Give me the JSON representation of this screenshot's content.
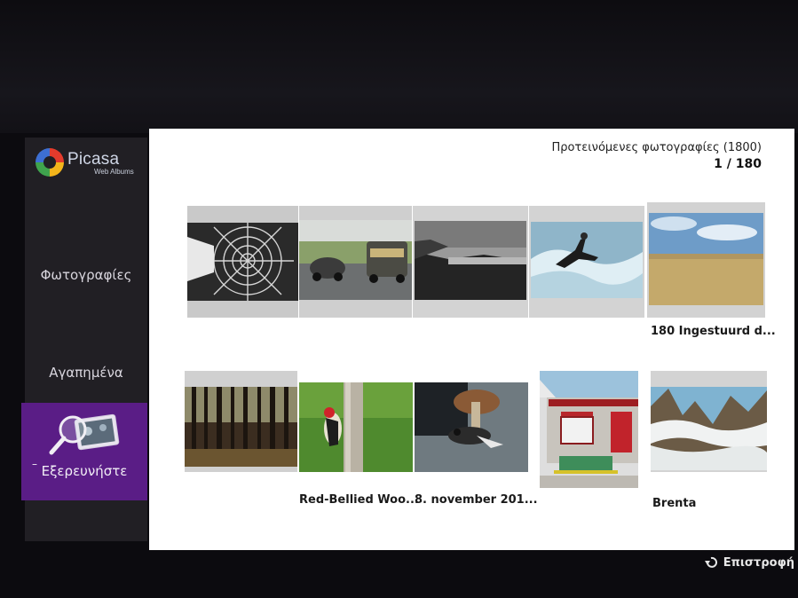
{
  "app": {
    "logo_name": "Picasa",
    "logo_sub": "Web Albums"
  },
  "sidebar": {
    "items": [
      {
        "label": "Φωτογραφίες",
        "icon": "photos"
      },
      {
        "label": "Αγαπημένα",
        "icon": "favorites"
      },
      {
        "label": "Εξερευνήστε",
        "icon": "explore-magnifier-icon",
        "selected": true
      }
    ]
  },
  "header": {
    "title": "Προτεινόμενες φωτογραφίες (1800)",
    "page_indicator": "1 / 180"
  },
  "grid": {
    "row1": [
      {
        "scene": "spiral-architecture",
        "caption": ""
      },
      {
        "scene": "vintage-cars",
        "caption": ""
      },
      {
        "scene": "rocky-coast-bw",
        "caption": ""
      },
      {
        "scene": "surfer",
        "caption": ""
      },
      {
        "scene": "wheat-field-sky",
        "caption": "180 Ingestuurd d..."
      }
    ],
    "row2": [
      {
        "scene": "forest",
        "caption": ""
      },
      {
        "scene": "woodpecker",
        "caption": "Red-Bellied Woo..."
      },
      {
        "scene": "mushroom-bird",
        "caption": "8. november 201..."
      },
      {
        "scene": "red-door-house",
        "caption": ""
      },
      {
        "scene": "mountain-clouds",
        "caption": "Brenta"
      }
    ]
  },
  "footer": {
    "back_label": "Επιστροφή",
    "back_icon": "return-arrow-icon"
  },
  "colors": {
    "selected_nav": "#5a1d86",
    "sidebar_bg": "#211f24",
    "panel_bg": "#ffffff"
  }
}
